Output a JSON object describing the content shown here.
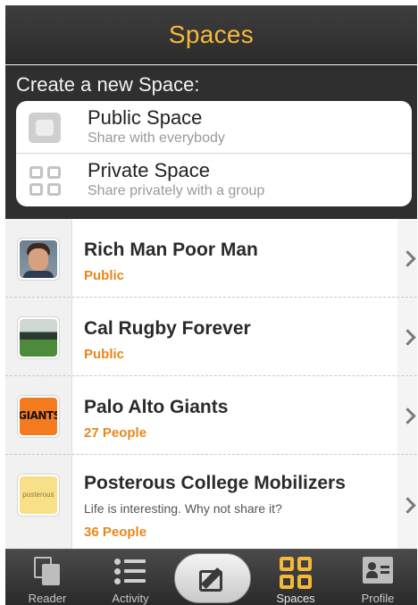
{
  "header": {
    "title": "Spaces"
  },
  "create": {
    "label": "Create a new Space:",
    "options": [
      {
        "title": "Public Space",
        "subtitle": "Share with everybody",
        "icon": "public-space-icon"
      },
      {
        "title": "Private Space",
        "subtitle": "Share privately with a group",
        "icon": "private-space-icon"
      }
    ]
  },
  "spaces": [
    {
      "title": "Rich Man Poor Man",
      "sub": "Public",
      "thumb": "profile-photo"
    },
    {
      "title": "Cal Rugby Forever",
      "sub": "Public",
      "thumb": "rugby-field-photo"
    },
    {
      "title": "Palo Alto Giants",
      "sub": "27 People",
      "thumb": "giants-logo",
      "thumb_text": "GIANTS"
    },
    {
      "title": "Posterous College Mobilizers",
      "desc": "Life is interesting.  Why not share it?",
      "sub": "36 People",
      "thumb": "posterous-logo",
      "thumb_text": "posterous"
    }
  ],
  "tabbar": {
    "tabs": [
      {
        "label": "Reader",
        "icon": "reader-icon"
      },
      {
        "label": "Activity",
        "icon": "activity-icon"
      },
      {
        "label": "",
        "icon": "compose-icon"
      },
      {
        "label": "Spaces",
        "icon": "spaces-icon",
        "active": true
      },
      {
        "label": "Profile",
        "icon": "profile-icon"
      }
    ]
  },
  "colors": {
    "accent": "#f5b93a",
    "orange_text": "#e8861b",
    "header_bg": "#2f2f2f"
  }
}
